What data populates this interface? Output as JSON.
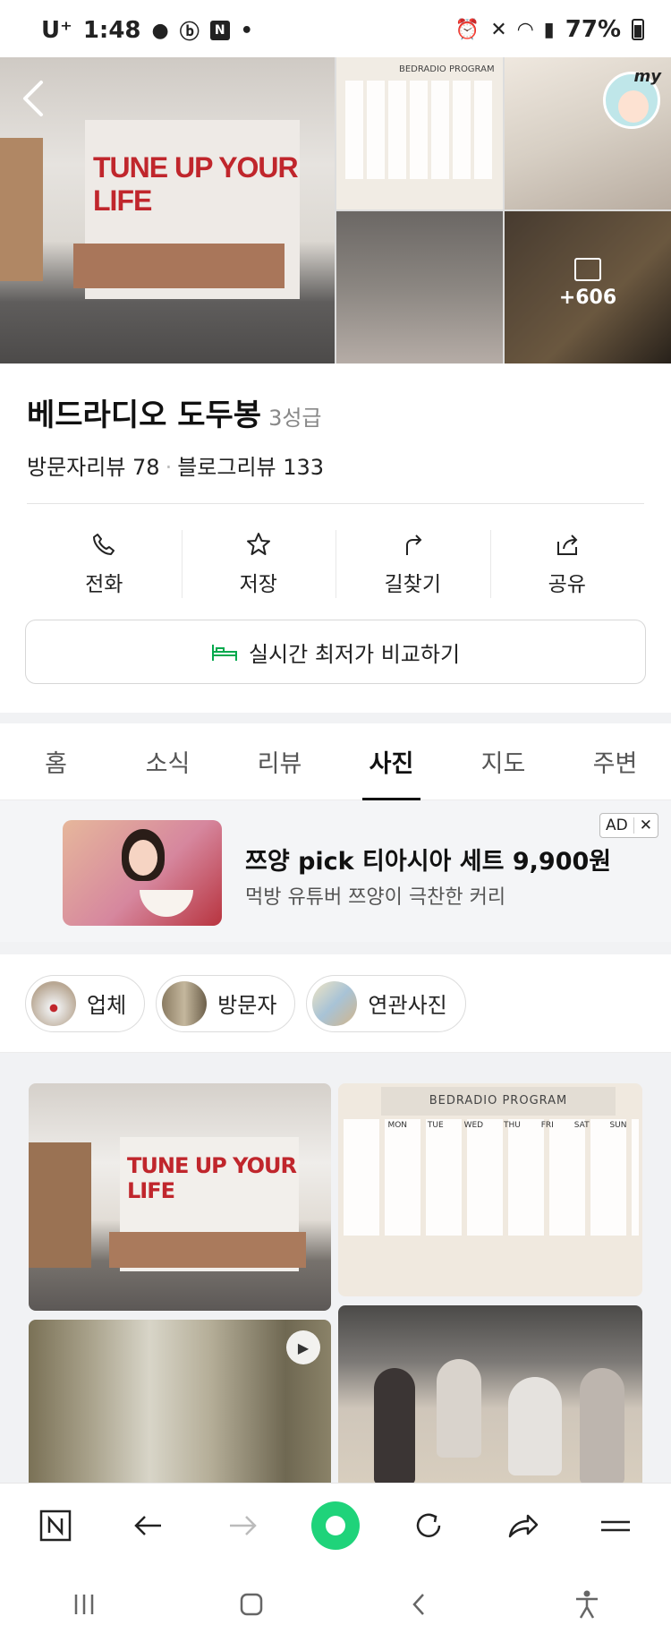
{
  "status_bar": {
    "carrier": "U⁺",
    "time": "1:48",
    "battery": "77%"
  },
  "hero": {
    "slogan": "TUNE UP YOUR LIFE",
    "program_title": "BEDRADIO  PROGRAM",
    "more_photos": "+606",
    "avatar_label": "my"
  },
  "place": {
    "name": "베드라디오 도두봉",
    "grade": "3성급",
    "visitor_reviews": "방문자리뷰 78",
    "blog_reviews": "블로그리뷰 133"
  },
  "actions": [
    {
      "label": "전화",
      "icon": "phone-icon"
    },
    {
      "label": "저장",
      "icon": "star-icon"
    },
    {
      "label": "길찾기",
      "icon": "directions-icon"
    },
    {
      "label": "공유",
      "icon": "share-icon"
    }
  ],
  "compare_button": "실시간 최저가 비교하기",
  "tabs": [
    "홈",
    "소식",
    "리뷰",
    "사진",
    "지도",
    "주변"
  ],
  "active_tab": "사진",
  "ad": {
    "title": "쯔양 pick 티아시아 세트 9,900원",
    "subtitle": "먹방 유튜버 쯔양이 극찬한 커리",
    "badge": "AD",
    "close": "✕"
  },
  "filter_chips": [
    "업체",
    "방문자",
    "연관사진"
  ],
  "photos": {
    "slogan": "TUNE UP YOUR LIFE",
    "program_title": "BEDRADIO  PROGRAM",
    "days": [
      "MON",
      "TUE",
      "WED",
      "THU",
      "FRI",
      "SAT",
      "SUN"
    ]
  },
  "colors": {
    "accent_green": "#1fd37a",
    "slogan_red": "#c0262c",
    "bed_icon_green": "#03a94d"
  }
}
